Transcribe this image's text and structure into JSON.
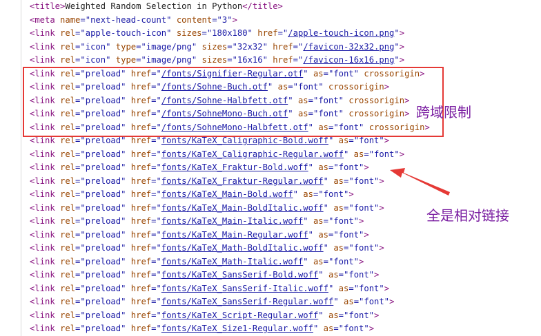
{
  "lines": [
    {
      "kind": "title",
      "open": "<title>",
      "text": "Weighted Random Selection in Python",
      "close": "</title>"
    },
    {
      "kind": "meta",
      "open": "<meta ",
      "a1": "name",
      "v1": "\"next-head-count\"",
      "a2": "content",
      "v2": "\"3\"",
      "close": ">"
    },
    {
      "kind": "icon",
      "open": "<link ",
      "rel": "\"apple-touch-icon\"",
      "sizes": "\"180x180\"",
      "href": "/apple-touch-icon.png",
      "close": ">"
    },
    {
      "kind": "icon-typed",
      "open": "<link ",
      "rel": "\"icon\"",
      "type": "\"image/png\"",
      "sizes": "\"32x32\"",
      "href": "/favicon-32x32.png",
      "close": ">"
    },
    {
      "kind": "icon-typed",
      "open": "<link ",
      "rel": "\"icon\"",
      "type": "\"image/png\"",
      "sizes": "\"16x16\"",
      "href": "/favicon-16x16.png",
      "close": ">"
    },
    {
      "kind": "preload-cors",
      "open": "<link ",
      "rel": "\"preload\"",
      "href": "/fonts/Signifier-Regular.otf",
      "as": "\"font\"",
      "cors": "crossorigin",
      "close": ">"
    },
    {
      "kind": "preload-cors",
      "open": "<link ",
      "rel": "\"preload\"",
      "href": "/fonts/Sohne-Buch.otf",
      "as": "\"font\"",
      "cors": "crossorigin",
      "close": ">"
    },
    {
      "kind": "preload-cors",
      "open": "<link ",
      "rel": "\"preload\"",
      "href": "/fonts/Sohne-Halbfett.otf",
      "as": "\"font\"",
      "cors": "crossorigin",
      "close": ">"
    },
    {
      "kind": "preload-cors",
      "open": "<link ",
      "rel": "\"preload\"",
      "href": "/fonts/SohneMono-Buch.otf",
      "as": "\"font\"",
      "cors": "crossorigin",
      "close": ">"
    },
    {
      "kind": "preload-cors",
      "open": "<link ",
      "rel": "\"preload\"",
      "href": "/fonts/SohneMono-Halbfett.otf",
      "as": "\"font\"",
      "cors": "crossorigin",
      "close": ">"
    },
    {
      "kind": "preload",
      "open": "<link ",
      "rel": "\"preload\"",
      "href": "fonts/KaTeX_Caligraphic-Bold.woff",
      "as": "\"font\"",
      "close": ">"
    },
    {
      "kind": "preload",
      "open": "<link ",
      "rel": "\"preload\"",
      "href": "fonts/KaTeX_Caligraphic-Regular.woff",
      "as": "\"font\"",
      "close": ">"
    },
    {
      "kind": "preload",
      "open": "<link ",
      "rel": "\"preload\"",
      "href": "fonts/KaTeX_Fraktur-Bold.woff",
      "as": "\"font\"",
      "close": ">"
    },
    {
      "kind": "preload",
      "open": "<link ",
      "rel": "\"preload\"",
      "href": "fonts/KaTeX_Fraktur-Regular.woff",
      "as": "\"font\"",
      "close": ">"
    },
    {
      "kind": "preload",
      "open": "<link ",
      "rel": "\"preload\"",
      "href": "fonts/KaTeX_Main-Bold.woff",
      "as": "\"font\"",
      "close": ">"
    },
    {
      "kind": "preload",
      "open": "<link ",
      "rel": "\"preload\"",
      "href": "fonts/KaTeX_Main-BoldItalic.woff",
      "as": "\"font\"",
      "close": ">"
    },
    {
      "kind": "preload",
      "open": "<link ",
      "rel": "\"preload\"",
      "href": "fonts/KaTeX_Main-Italic.woff",
      "as": "\"font\"",
      "close": ">"
    },
    {
      "kind": "preload",
      "open": "<link ",
      "rel": "\"preload\"",
      "href": "fonts/KaTeX_Main-Regular.woff",
      "as": "\"font\"",
      "close": ">"
    },
    {
      "kind": "preload",
      "open": "<link ",
      "rel": "\"preload\"",
      "href": "fonts/KaTeX_Math-BoldItalic.woff",
      "as": "\"font\"",
      "close": ">"
    },
    {
      "kind": "preload",
      "open": "<link ",
      "rel": "\"preload\"",
      "href": "fonts/KaTeX_Math-Italic.woff",
      "as": "\"font\"",
      "close": ">"
    },
    {
      "kind": "preload",
      "open": "<link ",
      "rel": "\"preload\"",
      "href": "fonts/KaTeX_SansSerif-Bold.woff",
      "as": "\"font\"",
      "close": ">"
    },
    {
      "kind": "preload",
      "open": "<link ",
      "rel": "\"preload\"",
      "href": "fonts/KaTeX_SansSerif-Italic.woff",
      "as": "\"font\"",
      "close": ">"
    },
    {
      "kind": "preload",
      "open": "<link ",
      "rel": "\"preload\"",
      "href": "fonts/KaTeX_SansSerif-Regular.woff",
      "as": "\"font\"",
      "close": ">"
    },
    {
      "kind": "preload",
      "open": "<link ",
      "rel": "\"preload\"",
      "href": "fonts/KaTeX_Script-Regular.woff",
      "as": "\"font\"",
      "close": ">"
    },
    {
      "kind": "preload",
      "open": "<link ",
      "rel": "\"preload\"",
      "href": "fonts/KaTeX_Size1-Regular.woff",
      "as": "\"font\"",
      "close": ">"
    }
  ],
  "annotations": {
    "box_label": "跨域限制",
    "arrow_label": "全是相对链接"
  },
  "colors": {
    "tag": "#881280",
    "attr": "#994500",
    "value": "#1a1aa6",
    "box": "#e53935",
    "label": "#7b1fa2"
  }
}
